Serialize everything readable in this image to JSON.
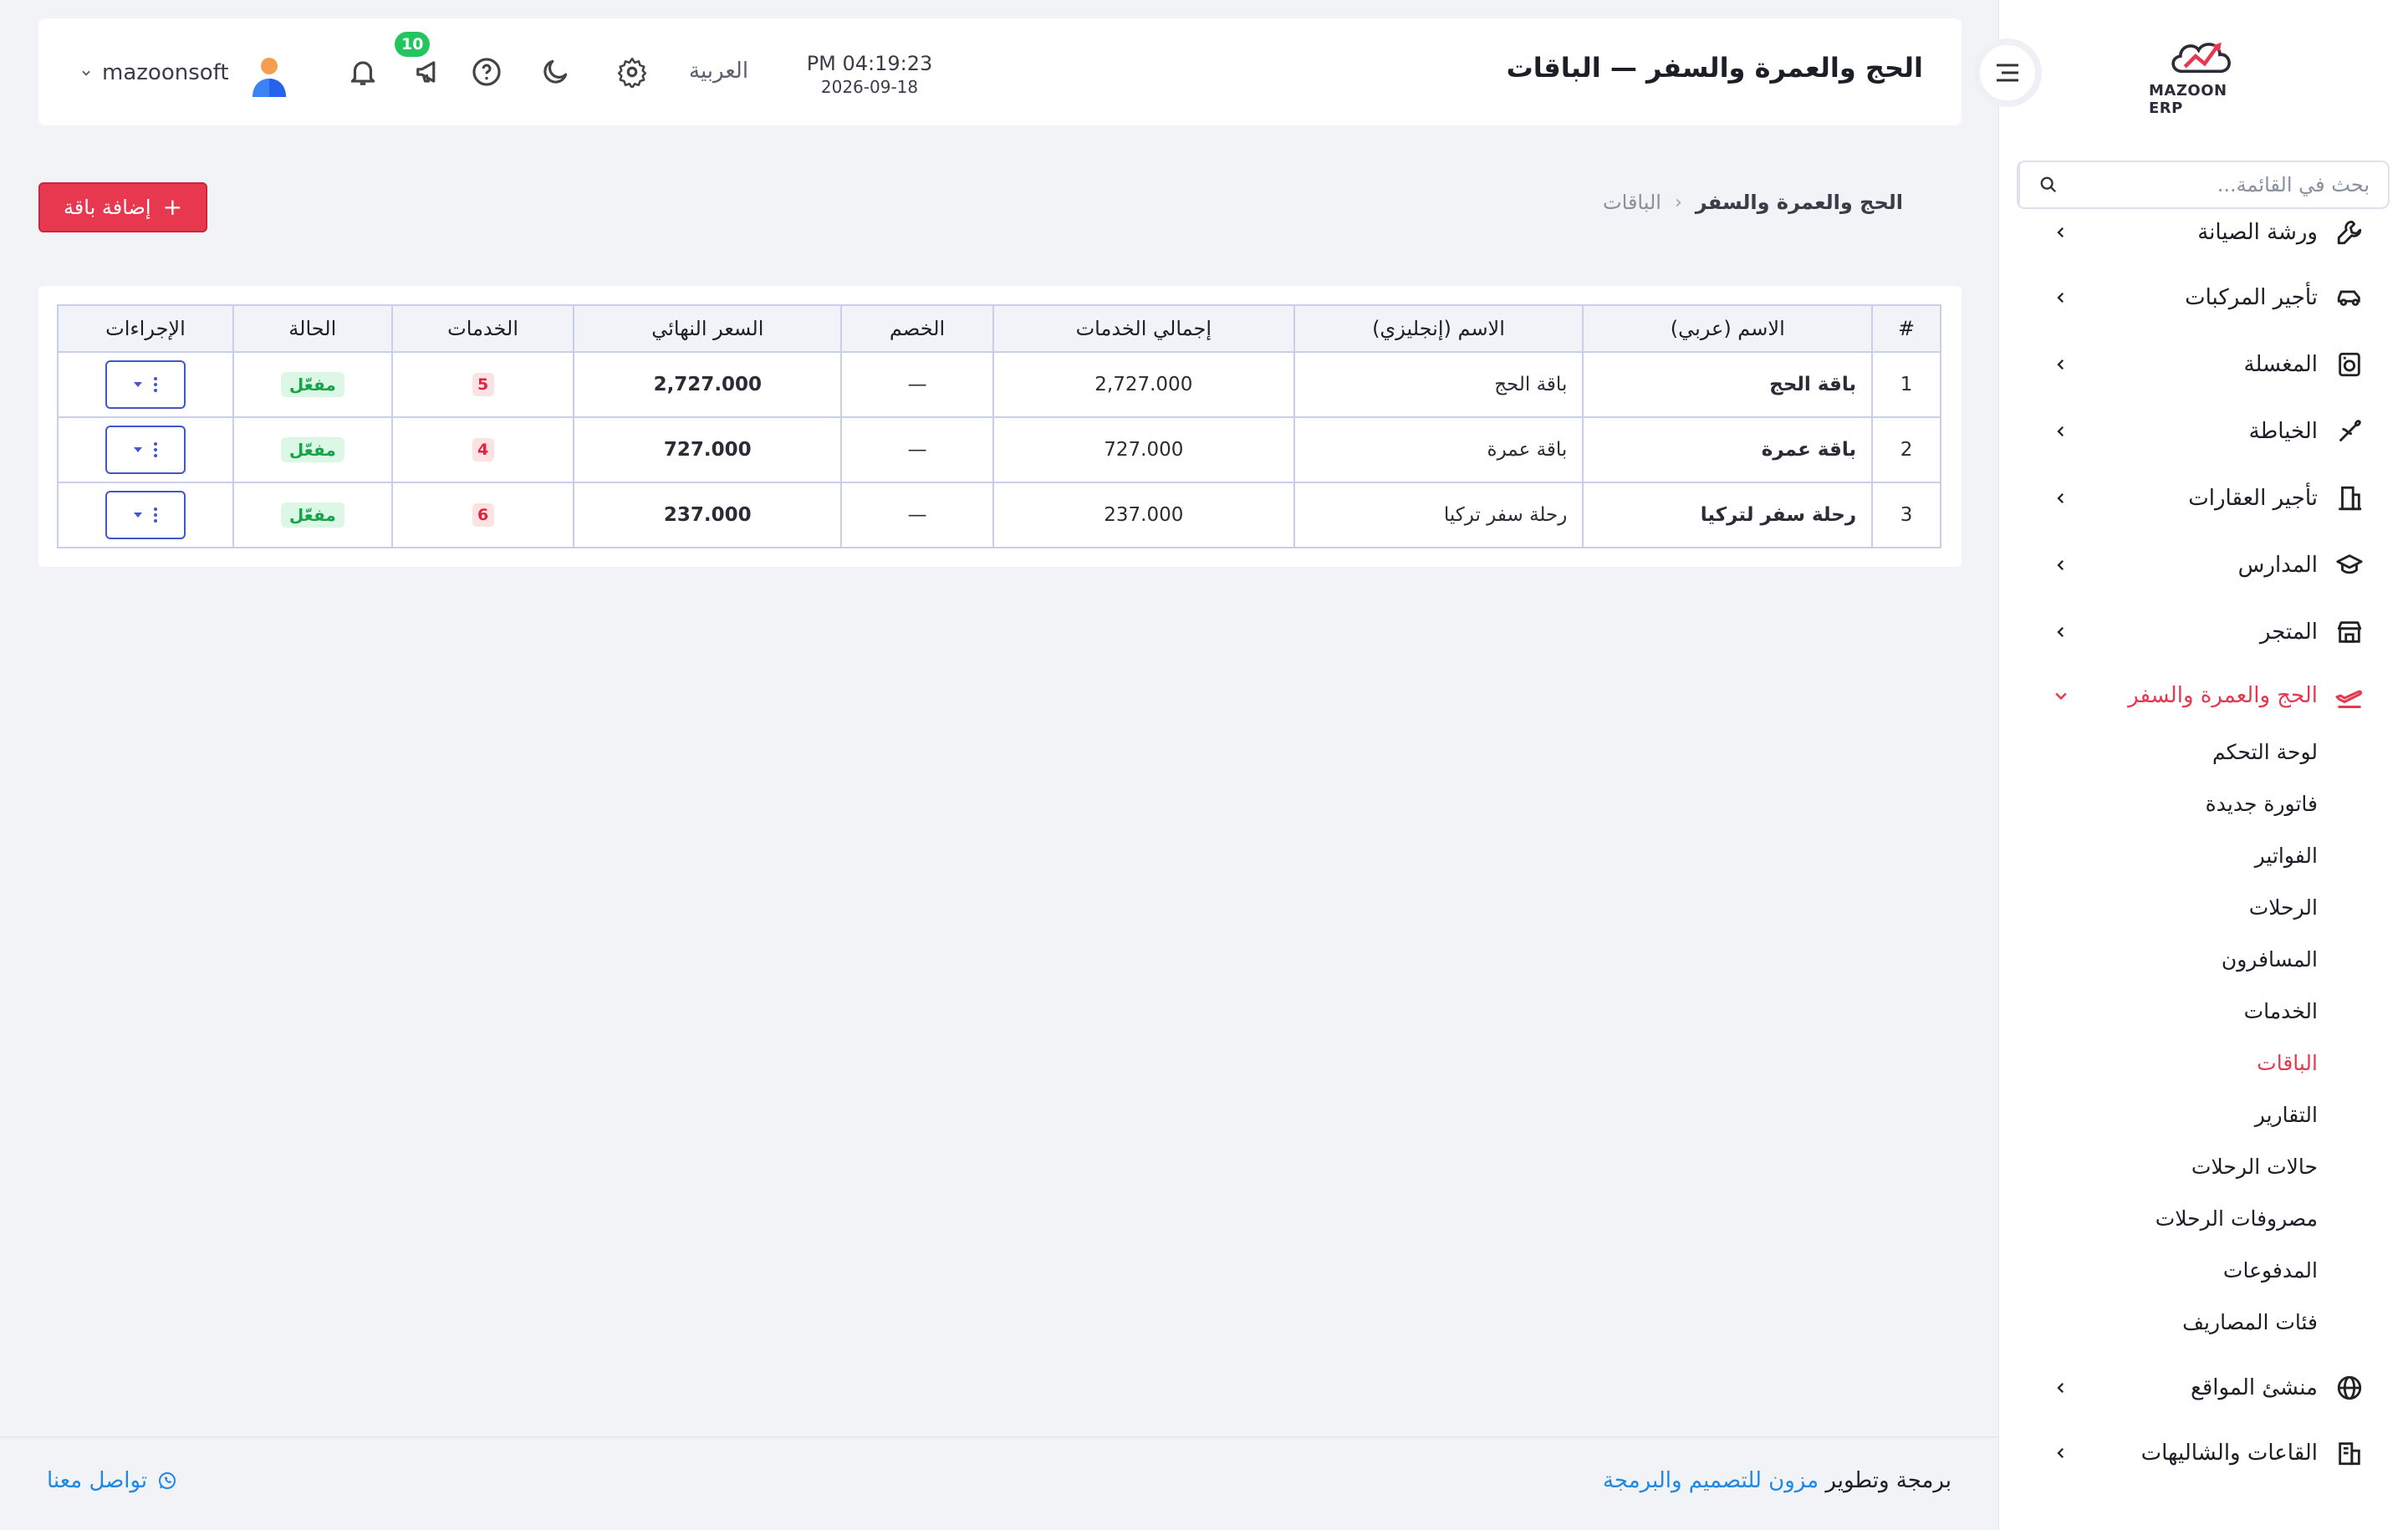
{
  "brand": {
    "logo_text": "MAZOON ERP",
    "accent": "#e8384f"
  },
  "sidebar": {
    "search_placeholder": "بحث في القائمة...",
    "menu": [
      {
        "label": "ورشة الصيانة",
        "icon": "wrench-icon"
      },
      {
        "label": "تأجير المركبات",
        "icon": "car-icon"
      },
      {
        "label": "المغسلة",
        "icon": "washing-machine-icon"
      },
      {
        "label": "الخياطة",
        "icon": "needle-icon"
      },
      {
        "label": "تأجير العقارات",
        "icon": "building-icon"
      },
      {
        "label": "المدارس",
        "icon": "graduation-cap-icon"
      },
      {
        "label": "المتجر",
        "icon": "store-icon"
      },
      {
        "label": "الحج والعمرة والسفر",
        "icon": "plane-icon",
        "expanded": true
      }
    ],
    "submenu": [
      "لوحة التحكم",
      "فاتورة جديدة",
      "الفواتير",
      "الرحلات",
      "المسافرون",
      "الخدمات",
      "الباقات",
      "التقارير",
      "حالات الرحلات",
      "مصروفات الرحلات",
      "المدفوعات",
      "فئات المصاريف"
    ],
    "active_submenu": "الباقات",
    "menu_after": [
      {
        "label": "منشئ المواقع",
        "icon": "globe-icon"
      },
      {
        "label": "القاعات والشاليهات",
        "icon": "hall-icon"
      }
    ]
  },
  "header": {
    "title": "الحج والعمرة والسفر — الباقات",
    "time": "PM 04:19:23",
    "date": "2026-09-18",
    "language": "العربية",
    "notifications_count": "10",
    "username": "mazoonsoft"
  },
  "breadcrumb": {
    "root": "الحج والعمرة والسفر",
    "separator": "‹",
    "current": "الباقات"
  },
  "add_button": {
    "label": "إضافة باقة",
    "plus": "+"
  },
  "table": {
    "headers": {
      "num": "#",
      "name_ar": "الاسم (عربي)",
      "name_en": "الاسم (إنجليزي)",
      "services_total": "إجمالي الخدمات",
      "discount": "الخصم",
      "final_price": "السعر النهائي",
      "services": "الخدمات",
      "status": "الحالة",
      "actions": "الإجراءات"
    },
    "rows": [
      {
        "num": "1",
        "name_ar": "باقة الحج",
        "name_en": "باقة الحج",
        "services_total": "2,727.000",
        "discount": "—",
        "final_price": "2,727.000",
        "services": "5",
        "status": "مفعّل"
      },
      {
        "num": "2",
        "name_ar": "باقة عمرة",
        "name_en": "باقة عمرة",
        "services_total": "727.000",
        "discount": "—",
        "final_price": "727.000",
        "services": "4",
        "status": "مفعّل"
      },
      {
        "num": "3",
        "name_ar": "رحلة سفر لتركيا",
        "name_en": "رحلة سفر تركيا",
        "services_total": "237.000",
        "discount": "—",
        "final_price": "237.000",
        "services": "6",
        "status": "مفعّل"
      }
    ]
  },
  "footer": {
    "credit_prefix": "برمجة وتطوير",
    "credit_link": "مزون للتصميم والبرمجة",
    "contact": "تواصل معنا"
  }
}
